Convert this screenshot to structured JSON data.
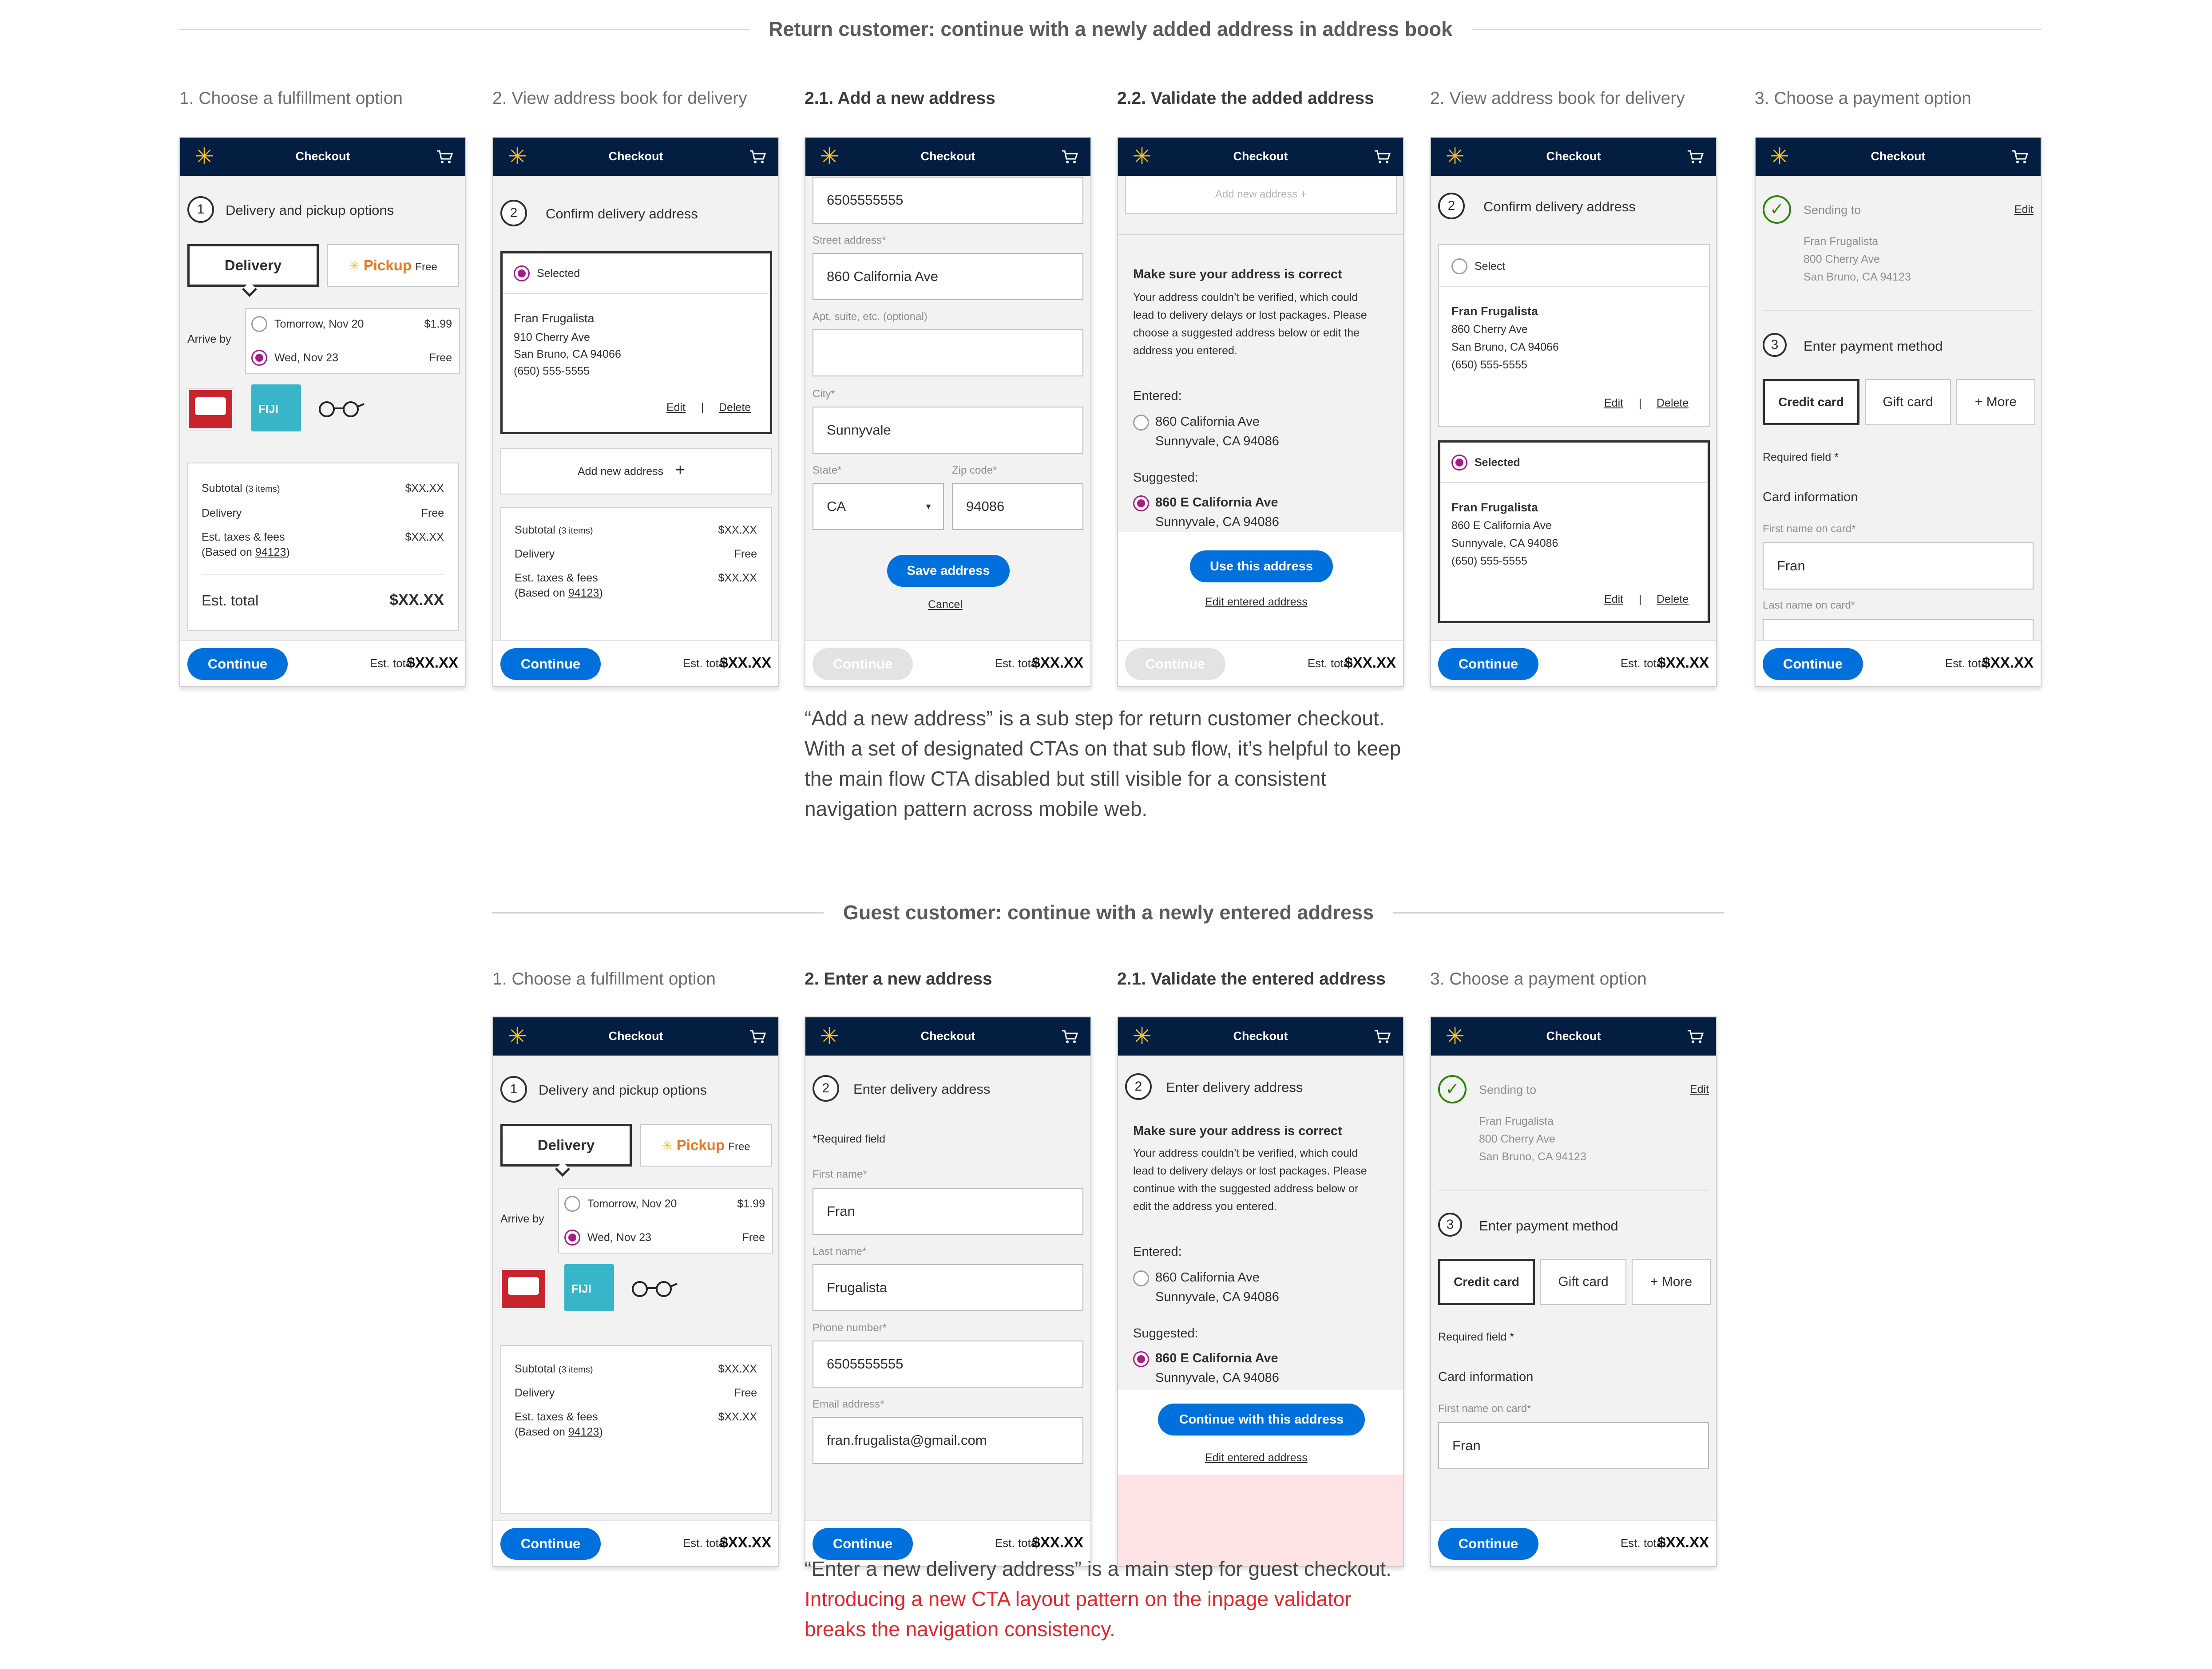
{
  "section1": {
    "title": "Return customer: continue with a newly added address in address book",
    "captions": [
      "1. Choose a fulfillment option",
      "2. View address book for delivery",
      "2.1. Add a new address",
      "2.2. Validate the added address",
      "2. View address book for delivery",
      "3. Choose a payment option"
    ],
    "note": "“Add a new address” is a sub step for return customer checkout. With a set of designated CTAs on that sub flow, it’s helpful to keep the main flow CTA disabled but still visible for a consistent navigation pattern across mobile web."
  },
  "section2": {
    "title": "Guest customer: continue with a newly entered address",
    "captions": [
      "1. Choose a fulfillment option",
      "2. Enter a new address",
      "2.1. Validate the entered address",
      "3. Choose a payment option"
    ],
    "note_line1": "“Enter a new delivery address” is a main step for guest checkout.",
    "note_red": "Introducing a new CTA layout pattern on the inpage validator breaks the navigation consistency."
  },
  "common": {
    "header_title": "Checkout",
    "continue": "Continue",
    "est_total_label": "Est. total",
    "est_total_value": "$XX.XX",
    "edit": "Edit",
    "delete": "Delete",
    "divider": "|",
    "accent_blue": "#0071dc",
    "navy": "#041e42",
    "spark_yellow": "#ffc220",
    "select_magenta": "#a81b89"
  },
  "fulfillment": {
    "step": "1",
    "title": "Delivery and pickup options",
    "delivery": "Delivery",
    "pickup": "Pickup",
    "pickup_free": "Free",
    "arrive_by": "Arrive by",
    "opt1_date": "Tomorrow, Nov 20",
    "opt1_price": "$1.99",
    "opt2_date": "Wed, Nov 23",
    "opt2_price": "Free",
    "fiji": "FIJI",
    "subtotal": "Subtotal",
    "subtotal_items": "(3 items)",
    "subtotal_val": "$XX.XX",
    "delivery_label": "Delivery",
    "delivery_val": "Free",
    "taxes": "Est. taxes & fees",
    "based_on": "(Based on ",
    "zip": "94123",
    "close_paren": ")",
    "taxes_val": "$XX.XX",
    "est_total": "Est. total",
    "est_total_val": "$XX.XX"
  },
  "addressbook": {
    "step": "2",
    "title": "Confirm delivery address",
    "selected": "Selected",
    "select": "Select",
    "name": "Fran Frugalista",
    "line1_old": "910 Cherry Ave",
    "city_old": "San Bruno, CA 94066",
    "phone": "(650) 555-5555",
    "add_new": "Add new address",
    "new_line1": "860 E California Ave",
    "new_city": "Sunnyvale, CA 94086",
    "ab2_line1": "860 Cherry Ave"
  },
  "addform": {
    "phone_val": "6505555555",
    "street_label": "Street address*",
    "street_val": "860 California Ave",
    "apt_label": "Apt, suite, etc. (optional)",
    "city_label": "City*",
    "city_val": "Sunnyvale",
    "state_label": "State*",
    "state_val": "CA",
    "zip_label": "Zip code*",
    "zip_val": "94086",
    "save": "Save address",
    "cancel": "Cancel"
  },
  "validate": {
    "add_new": "Add new address",
    "title": "Make sure your address is correct",
    "body1": [
      "Your address couldn’t be verified, which could",
      "lead to delivery delays or lost packages. Please",
      "choose a suggested address below or edit the",
      "address you entered."
    ],
    "body2": [
      "Your address couldn’t be verified, which could",
      "lead to delivery delays or lost packages. Please",
      "continue with the suggested address below or",
      "edit the address you entered."
    ],
    "entered": "Entered:",
    "entered_l1": "860 California Ave",
    "entered_l2": "Sunnyvale, CA 94086",
    "suggested": "Suggested:",
    "sugg_l1": "860 E California Ave",
    "sugg_l2": "Sunnyvale, CA 94086",
    "use_this": "Use this address",
    "continue_this": "Continue with this address",
    "edit_entered": "Edit entered address",
    "step_title": "Enter delivery address"
  },
  "payment": {
    "sending_to": "Sending to",
    "edit": "Edit",
    "name": "Fran Frugalista",
    "l1": "800 Cherry Ave",
    "l2": "San Bruno, CA 94123",
    "step": "3",
    "title": "Enter payment method",
    "credit": "Credit card",
    "gift": "Gift card",
    "more": "+ More",
    "required": "Required field *",
    "card_info": "Card information",
    "first_label": "First name on card*",
    "first_val": "Fran",
    "last_label": "Last name on card*"
  },
  "guestform": {
    "step": "2",
    "title": "Enter delivery address",
    "required": "*Required field",
    "first_label": "First name*",
    "first_val": "Fran",
    "last_label": "Last name*",
    "last_val": "Frugalista",
    "phone_label": "Phone number*",
    "phone_val": "6505555555",
    "email_label": "Email address*",
    "email_val": "fran.frugalista@gmail.com"
  }
}
